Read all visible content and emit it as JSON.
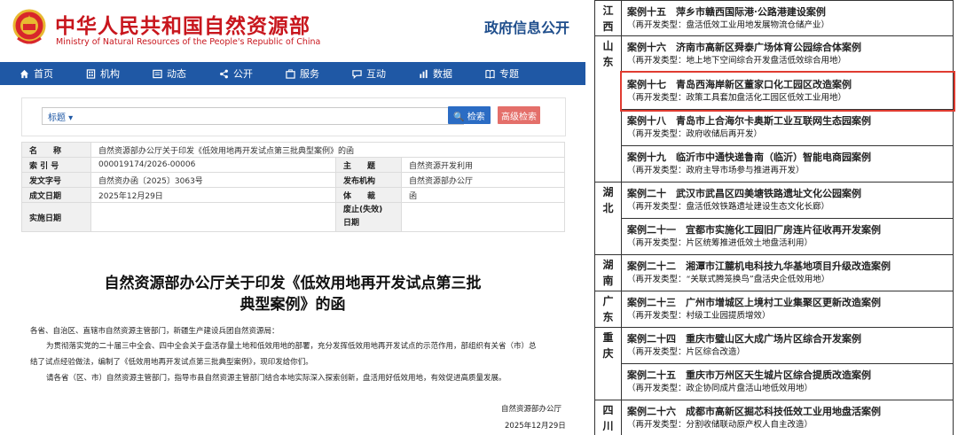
{
  "header": {
    "ministry_cn": "中华人民共和国自然资源部",
    "ministry_en": "Ministry of Natural Resources of the People's Republic of China",
    "gov_info": "政府信息公开"
  },
  "nav": [
    {
      "label": "首页",
      "icon": "home-icon"
    },
    {
      "label": "机构",
      "icon": "building-icon"
    },
    {
      "label": "动态",
      "icon": "news-icon"
    },
    {
      "label": "公开",
      "icon": "share-icon"
    },
    {
      "label": "服务",
      "icon": "service-icon"
    },
    {
      "label": "互动",
      "icon": "chat-icon"
    },
    {
      "label": "数据",
      "icon": "chart-icon"
    },
    {
      "label": "专题",
      "icon": "book-icon"
    }
  ],
  "search": {
    "type_label": "标题 ▾",
    "placeholder": "",
    "search_btn": "🔍 检索",
    "advanced_btn": "高级检索"
  },
  "meta": {
    "name_label": "名　　称",
    "name_value": "自然资源部办公厅关于印发《低效用地再开发试点第三批典型案例》的函",
    "index_label": "索 引 号",
    "index_value": "000019174/2026-00006",
    "subject_label": "主　　题",
    "subject_value": "自然资源开发利用",
    "docno_label": "发文字号",
    "docno_value": "自然资办函〔2025〕3063号",
    "issuer_label": "发布机构",
    "issuer_value": "自然资源部办公厅",
    "date_label": "成文日期",
    "date_value": "2025年12月29日",
    "genre_label": "体　　裁",
    "genre_value": "函",
    "impl_label": "实施日期",
    "impl_value": "",
    "expire_label1": "废止(失效)",
    "expire_label2": "日期",
    "expire_value": ""
  },
  "doc": {
    "title_line1": "自然资源部办公厅关于印发《低效用地再开发试点第三批",
    "title_line2": "典型案例》的函",
    "salutation": "各省、自治区、直辖市自然资源主管部门，新疆生产建设兵团自然资源局：",
    "para1a": "为贯彻落实党的二十届三中全会、四中全会关于盘活存量土地和低效用地的部署，充分发挥低效用地再开发试点的示范作用，部组织有关省（市）总",
    "para1b": "结了试点经验做法，编制了《低效用地再开发试点第三批典型案例》，现印发给你们。",
    "para2": "请各省（区、市）自然资源主管部门，指导市县自然资源主管部门结合本地实际深入探索创新，盘活用好低效用地，有效促进高质量发展。",
    "sign_org": "自然资源部办公厅",
    "sign_date": "2025年12月29日"
  },
  "cases": [
    {
      "province": "江西",
      "items": [
        {
          "title": "案例十五　萍乡市赣西国际港·公路港建设案例",
          "type": "（再开发类型：盘活低效工业用地发展物流仓储产业）"
        }
      ]
    },
    {
      "province": "山东",
      "items": [
        {
          "title": "案例十六　济南市高新区舜泰广场体育公园综合体案例",
          "type": "（再开发类型：地上地下空间综合开发盘活低效综合用地）"
        },
        {
          "title": "案例十七　青岛西海岸新区董家口化工园区改造案例",
          "type": "（再开发类型：政策工具套加盘活化工园区低效工业用地）"
        },
        {
          "title": "案例十八　青岛市上合海尔卡奥斯工业互联网生态园案例",
          "type": "（再开发类型：政府收储后再开发）"
        },
        {
          "title": "案例十九　临沂市中通快递鲁南（临沂）智能电商园案例",
          "type": "（再开发类型：政府主导市场参与推进再开发）"
        }
      ]
    },
    {
      "province": "湖北",
      "items": [
        {
          "title": "案例二十　武汉市武昌区四美塘铁路遗址文化公园案例",
          "type": "（再开发类型：盘活低效铁路遗址建设生态文化长廊）"
        },
        {
          "title": "案例二十一　宜都市实施化工园旧厂房连片征收再开发案例",
          "type": "（再开发类型：片区统筹推进低效土地盘活利用）"
        }
      ]
    },
    {
      "province": "湖南",
      "items": [
        {
          "title": "案例二十二　湘潭市江麓机电科技九华基地项目升级改造案例",
          "type": "（再开发类型：“关联式腾笼换鸟”盘活央企低效用地）"
        }
      ]
    },
    {
      "province": "广东",
      "items": [
        {
          "title": "案例二十三　广州市增城区上境村工业集聚区更新改造案例",
          "type": "（再开发类型：村级工业园提质增效）"
        }
      ]
    },
    {
      "province": "重庆",
      "items": [
        {
          "title": "案例二十四　重庆市璧山区大成广场片区综合开发案例",
          "type": "（再开发类型：片区综合改造）"
        },
        {
          "title": "案例二十五　重庆市万州区天生城片区综合提质改造案例",
          "type": "（再开发类型：政企协同成片盘活山地低效用地）"
        }
      ]
    },
    {
      "province": "四川",
      "items": [
        {
          "title": "案例二十六　成都市高新区掘芯科技低效工业用地盘活案例",
          "type": "（再开发类型：分割收储联动原产权人自主改造）"
        }
      ]
    }
  ],
  "highlight_color": "#e03c31"
}
